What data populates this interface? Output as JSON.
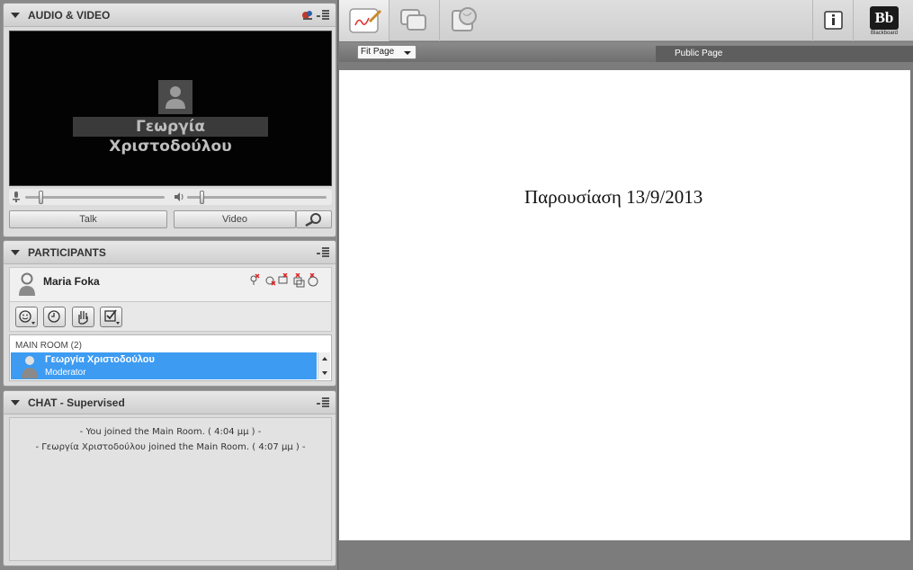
{
  "audio_video": {
    "title": "AUDIO & VIDEO",
    "camera_user_name": "Γεωργία Χριστοδούλου",
    "talk_label": "Talk",
    "video_label": "Video"
  },
  "participants": {
    "title": "PARTICIPANTS",
    "me": {
      "name": "Maria Foka"
    },
    "room": {
      "label": "MAIN ROOM",
      "count": "(2)",
      "users": [
        {
          "name": "Γεωργία Χριστοδούλου",
          "role": "Moderator"
        }
      ]
    }
  },
  "chat": {
    "title": "CHAT - Supervised",
    "messages": [
      "- You joined the Main Room. ( 4:04 μμ ) -",
      "- Γεωργία Χριστοδούλου joined the Main Room. ( 4:07 μμ ) -"
    ]
  },
  "toolbar": {
    "logo_text": "Bb",
    "logo_caption": "Blackboard"
  },
  "whiteboard": {
    "zoom_select": "Fit Page",
    "page_tab": "Public Page",
    "content_text": "Παρουσίαση 13/9/2013"
  },
  "colors": {
    "selection": "#3d9bf2",
    "panel_bg": "#dcdcdc",
    "page_bg": "#ffffff"
  }
}
